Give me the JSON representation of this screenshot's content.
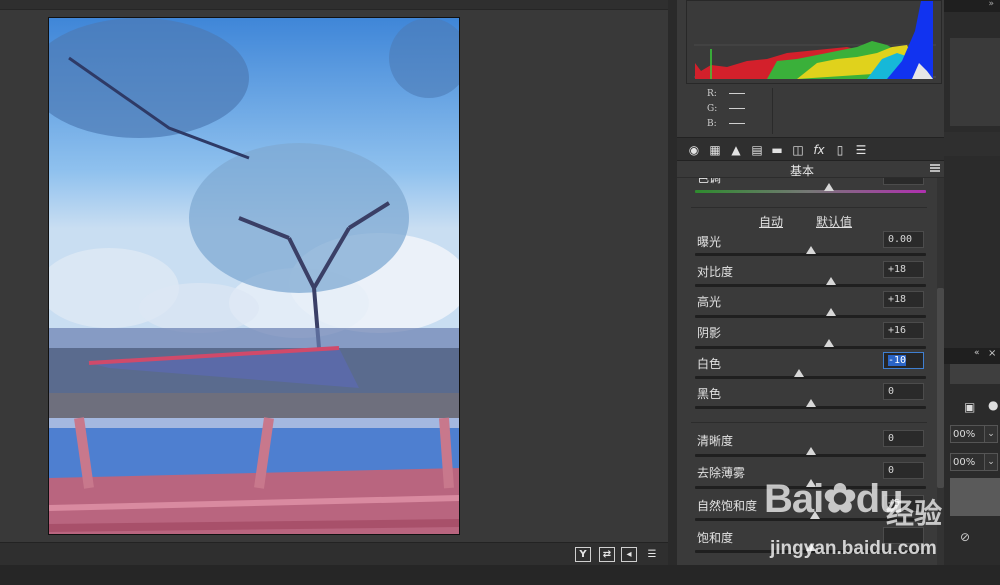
{
  "histogram": {
    "readout": [
      {
        "channel": "R:",
        "value": ""
      },
      {
        "channel": "G:",
        "value": ""
      },
      {
        "channel": "B:",
        "value": ""
      }
    ]
  },
  "panel": {
    "title": "基本",
    "auto_label": "自动",
    "default_label": "默认值"
  },
  "sliders": [
    {
      "id": "tint",
      "label": "色调",
      "value": ""
    },
    {
      "id": "exposure",
      "label": "曝光",
      "value": "0.00",
      "level": 0.5
    },
    {
      "id": "contrast",
      "label": "对比度",
      "value": "+18",
      "level": 0.59
    },
    {
      "id": "highlights",
      "label": "高光",
      "value": "+18",
      "level": 0.59
    },
    {
      "id": "shadows",
      "label": "阴影",
      "value": "+16",
      "level": 0.58
    },
    {
      "id": "whites",
      "label": "白色",
      "value": "-10",
      "level": 0.45,
      "active": true
    },
    {
      "id": "blacks",
      "label": "黑色",
      "value": "0",
      "level": 0.5
    },
    {
      "id": "clarity",
      "label": "清晰度",
      "value": "0",
      "level": 0.5
    },
    {
      "id": "dehaze",
      "label": "去除薄雾",
      "value": "0",
      "level": 0.5
    },
    {
      "id": "vibrance",
      "label": "自然饱和度",
      "value": "+5",
      "level": 0.52
    },
    {
      "id": "saturation",
      "label": "饱和度",
      "value": "",
      "level": 0.5
    }
  ],
  "view_buttons": [
    "Y",
    "⇄",
    "◂",
    "☰"
  ],
  "far_right": {
    "field1": "00%",
    "field2": "00%"
  },
  "watermark": {
    "brand": "Bai",
    "brand2": "du",
    "cn": "经验",
    "url": "jingyan.baidu.com"
  },
  "colors": {
    "panel_bg": "#3a3a3a",
    "active_field": "#2a64c5"
  }
}
